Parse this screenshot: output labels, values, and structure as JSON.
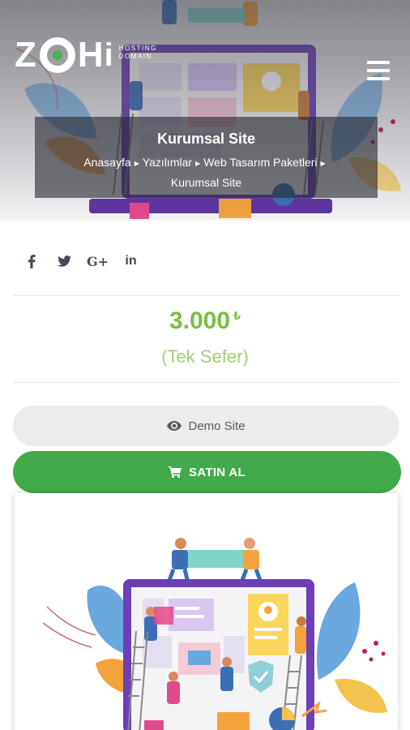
{
  "brand": {
    "logo_text": "ZOHi",
    "logo_sub_line1": "HOSTING",
    "logo_sub_line2": "DOMAIN",
    "accent_color": "#43aa49"
  },
  "header": {
    "menu_icon": "hamburger-menu-icon"
  },
  "page": {
    "title": "Kurumsal Site",
    "breadcrumb": [
      "Anasayfa",
      "Yazılımlar",
      "Web Tasarım Paketleri",
      "Kurumsal Site"
    ]
  },
  "social": {
    "icons": [
      "facebook-icon",
      "twitter-icon",
      "google-plus-icon",
      "linkedin-icon"
    ],
    "labels": [
      "f",
      "t",
      "G+",
      "in"
    ]
  },
  "price": {
    "amount": "3.000",
    "currency": "₺",
    "period": "(Tek Sefer)",
    "color": "#7cbf42"
  },
  "actions": {
    "demo_label": "Demo Site",
    "demo_icon": "eye-icon",
    "buy_label": "SATIN AL",
    "buy_icon": "shopping-cart-icon"
  }
}
